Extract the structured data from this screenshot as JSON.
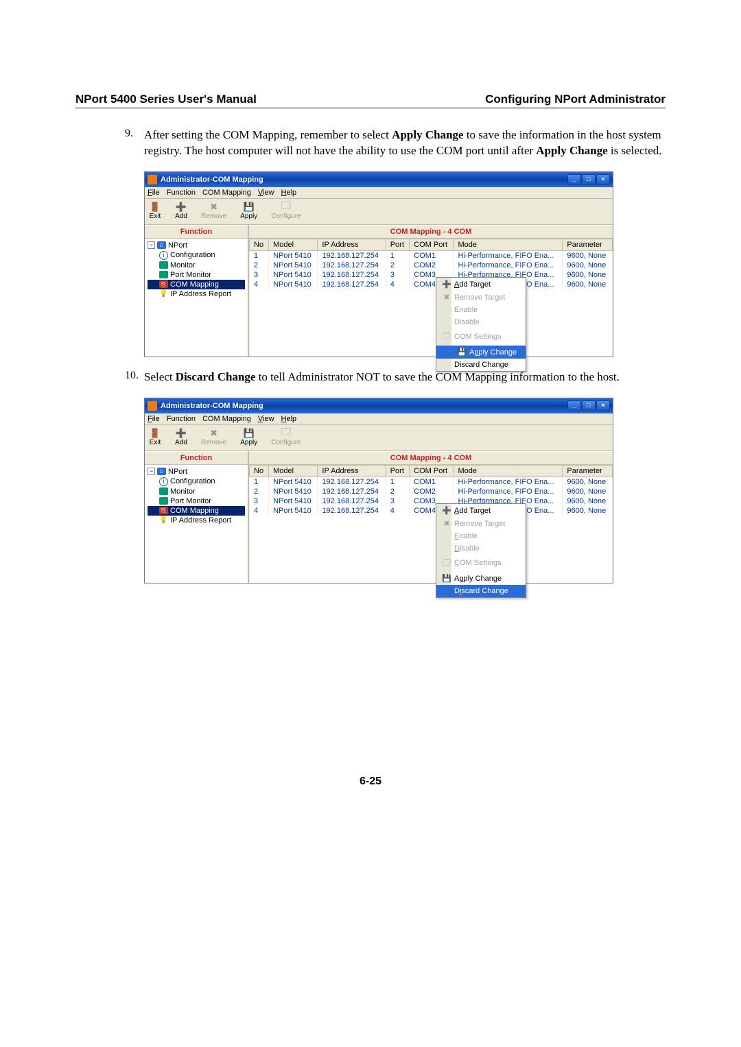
{
  "header": {
    "left": "NPort 5400 Series User's Manual",
    "right": "Configuring NPort Administrator"
  },
  "step9": {
    "num": "9.",
    "text_a": "After setting the COM Mapping, remember to select ",
    "bold_a": "Apply Change",
    "text_b": " to save the information in the host system registry. The host computer will not have the ability to use the COM port until after ",
    "bold_b": "Apply Change",
    "text_c": " is selected."
  },
  "step10": {
    "num": "10.",
    "text_a": "Select ",
    "bold_a": "Discard Change",
    "text_b": " to tell Administrator NOT to save the COM Mapping information to the host."
  },
  "appwindow": {
    "title": "Administrator-COM Mapping",
    "menu": [
      "File",
      "Function",
      "COM Mapping",
      "View",
      "Help"
    ],
    "toolbar": {
      "exit": "Exit",
      "add": "Add",
      "remove": "Remove",
      "apply": "Apply",
      "configure": "Configure"
    },
    "function_header": "Function",
    "main_header": "COM Mapping - 4 COM",
    "tree": {
      "root": "NPort",
      "items": [
        "Configuration",
        "Monitor",
        "Port Monitor",
        "COM Mapping",
        "IP Address Report"
      ]
    },
    "columns": [
      "No",
      "Model",
      "IP Address",
      "Port",
      "COM Port",
      "Mode",
      "Parameter"
    ],
    "rows": [
      {
        "no": "1",
        "model": "NPort 5410",
        "ip": "192.168.127.254",
        "port": "1",
        "com": "COM1",
        "mode": "Hi-Performance, FIFO Ena...",
        "param": "9600, None"
      },
      {
        "no": "2",
        "model": "NPort 5410",
        "ip": "192.168.127.254",
        "port": "2",
        "com": "COM2",
        "mode": "Hi-Performance, FIFO Ena...",
        "param": "9600, None"
      },
      {
        "no": "3",
        "model": "NPort 5410",
        "ip": "192.168.127.254",
        "port": "3",
        "com": "COM3",
        "mode": "Hi-Performance, FIFO Ena...",
        "param": "9600, None"
      },
      {
        "no": "4",
        "model": "NPort 5410",
        "ip": "192.168.127.254",
        "port": "4",
        "com": "COM4",
        "mode": "Hi-Performance, FIFO Ena...",
        "param": "9600, None"
      }
    ],
    "context_menu": {
      "add_target": "Add Target",
      "remove_target": "Remove Target",
      "enable": "Enable",
      "disable": "Disable",
      "com_settings": "COM Settings",
      "apply_change": "Apply Change",
      "discard_change": "Discard Change"
    }
  },
  "page_number": "6-25"
}
